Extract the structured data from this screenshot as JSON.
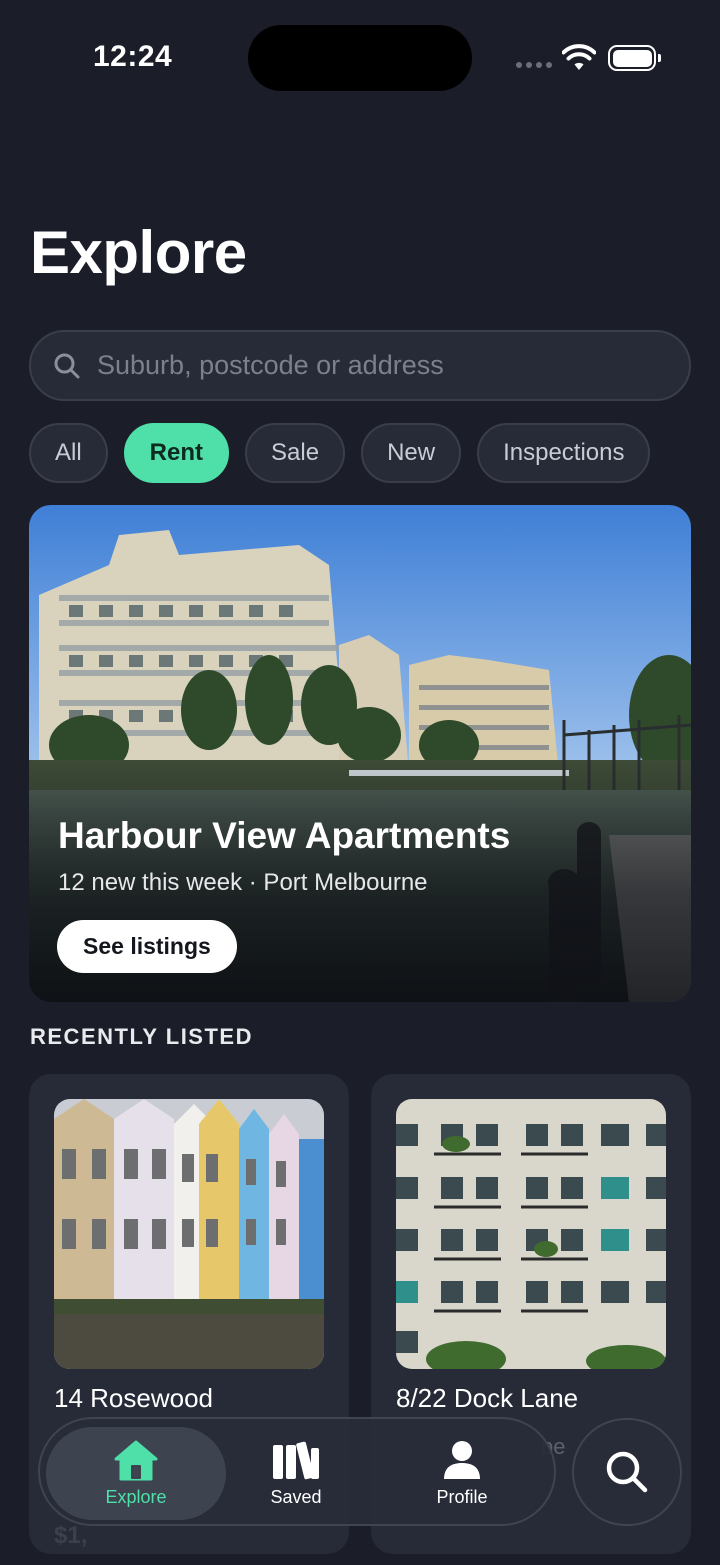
{
  "status_bar": {
    "time": "12:24"
  },
  "header": {
    "title": "Explore"
  },
  "search": {
    "placeholder": "Suburb, postcode or address",
    "value": ""
  },
  "filters": [
    {
      "label": "All",
      "active": false
    },
    {
      "label": "Rent",
      "active": true
    },
    {
      "label": "Sale",
      "active": false
    },
    {
      "label": "New",
      "active": false
    },
    {
      "label": "Inspections",
      "active": false
    }
  ],
  "featured": {
    "title": "Harbour View Apartments",
    "subtitle": "12 new this week · Port Melbourne",
    "button_label": "See listings"
  },
  "recent": {
    "heading": "RECENTLY LISTED",
    "listings": [
      {
        "title": "14 Rosewood",
        "price_partial": "$1,"
      },
      {
        "title": "8/22 Dock Lane",
        "detail_partial": "be"
      }
    ]
  },
  "tab_bar": {
    "tabs": [
      {
        "label": "Explore",
        "icon": "home-icon",
        "active": true
      },
      {
        "label": "Saved",
        "icon": "library-icon",
        "active": false
      },
      {
        "label": "Profile",
        "icon": "person-icon",
        "active": false
      }
    ],
    "search_icon": "search-icon"
  },
  "colors": {
    "accent": "#4ee0a8",
    "background": "#1b1e29",
    "surface": "#272b37"
  }
}
